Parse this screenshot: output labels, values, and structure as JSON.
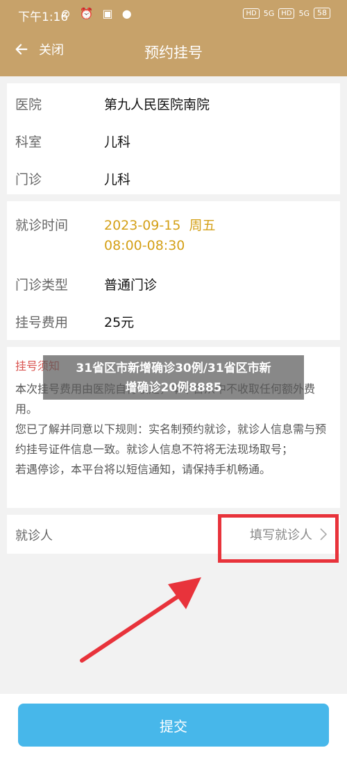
{
  "status_bar": {
    "time": "下午1:16",
    "left_icons": "⊘ ⏰ ▣ ●",
    "hd1": "HD",
    "sig1": "5G",
    "hd2": "HD",
    "sig2": "5G",
    "battery": "58"
  },
  "header": {
    "back_label": "关闭",
    "title": "预约挂号"
  },
  "hospital_info": [
    {
      "label": "医院",
      "value": "第九人民医院南院"
    },
    {
      "label": "科室",
      "value": "儿科"
    },
    {
      "label": "门诊",
      "value": "儿科"
    }
  ],
  "visit": {
    "time_label": "就诊时间",
    "time_line1": "2023-09-15  周五",
    "time_line2": "08:00-08:30",
    "type_label": "门诊类型",
    "type_value": "普通门诊",
    "fee_label": "挂号费用",
    "fee_value": "25元"
  },
  "notice": {
    "title": "挂号须知",
    "p1": "本次挂号费用由医院自行收定，本平台从中不收取任何额外费用。",
    "p2": "您已了解并同意以下规则：实名制预约就诊，就诊人信息需与预约挂号证件信息一致。就诊人信息不符将无法现场取号；",
    "p3": "若遇停诊，本平台将以短信通知，请保持手机畅通。"
  },
  "patient": {
    "label": "就诊人",
    "action": "填写就诊人"
  },
  "watermark": {
    "line1": "31省区市新增确诊30例/31省区市新",
    "line2": "增确诊20例8885"
  },
  "footer": {
    "submit_label": "提交"
  },
  "colors": {
    "brand": "#c7a26a",
    "accent_button": "#47b7ea",
    "highlight": "#e8333b",
    "date_text": "#d4a017",
    "notice_title": "#d9534f"
  }
}
